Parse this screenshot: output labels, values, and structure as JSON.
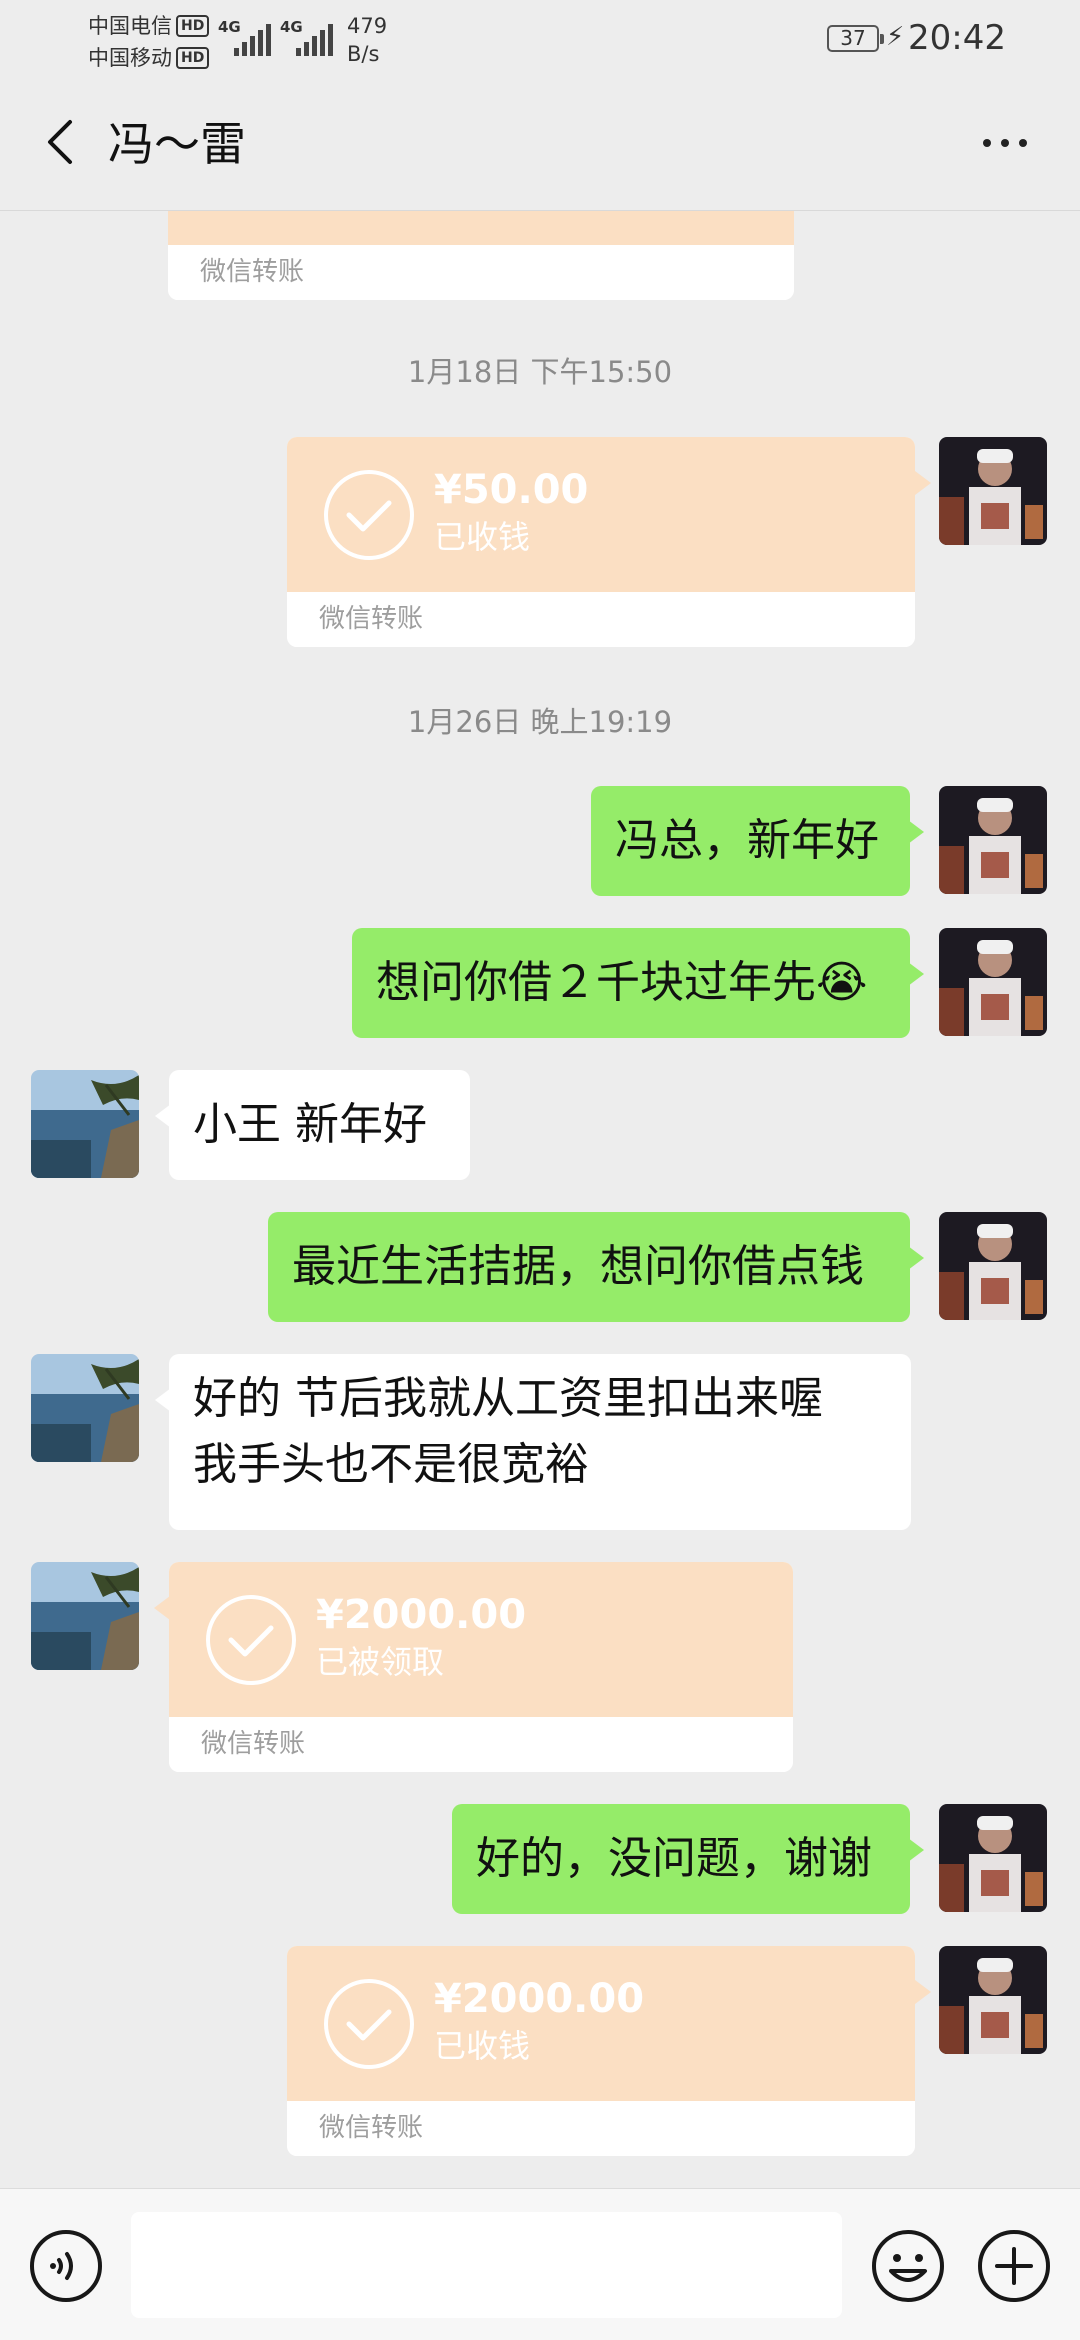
{
  "status_bar": {
    "carrier1": "中国电信",
    "carrier2": "中国移动",
    "hd": "HD",
    "net_type": "4G",
    "speed_value": "479",
    "speed_unit": "B/s",
    "battery": "37",
    "time": "20:42"
  },
  "header": {
    "title": "冯～雷",
    "back_icon": "chevron-left-icon",
    "more_icon": "more-dots-icon",
    "more_label": "···"
  },
  "messages": {
    "partial_transfer_label": "微信转账",
    "ts1": "1月18日 下午15:50",
    "transfer1": {
      "amount": "¥50.00",
      "status": "已收钱",
      "label": "微信转账"
    },
    "ts2": "1月26日 晚上19:19",
    "msg1": "冯总，新年好",
    "msg2": "想问你借２千块过年先",
    "msg2_emoji": "😭",
    "msg3": "小王  新年好",
    "msg4": "最近生活拮据，想问你借点钱",
    "msg5_line1": "好的  节后我就从工资里扣出来喔",
    "msg5_line2": "我手头也不是很宽裕",
    "transfer2": {
      "amount": "¥2000.00",
      "status": "已被领取",
      "label": "微信转账"
    },
    "msg6": "好的，没问题，谢谢",
    "transfer3": {
      "amount": "¥2000.00",
      "status": "已收钱",
      "label": "微信转账"
    }
  },
  "input_bar": {
    "voice_icon": "voice-icon",
    "emoji_icon": "emoji-icon",
    "plus_icon": "plus-icon",
    "input_value": ""
  },
  "colors": {
    "background": "#ededed",
    "green_bubble": "#95ec69",
    "transfer_orange": "#fbdfc3"
  }
}
